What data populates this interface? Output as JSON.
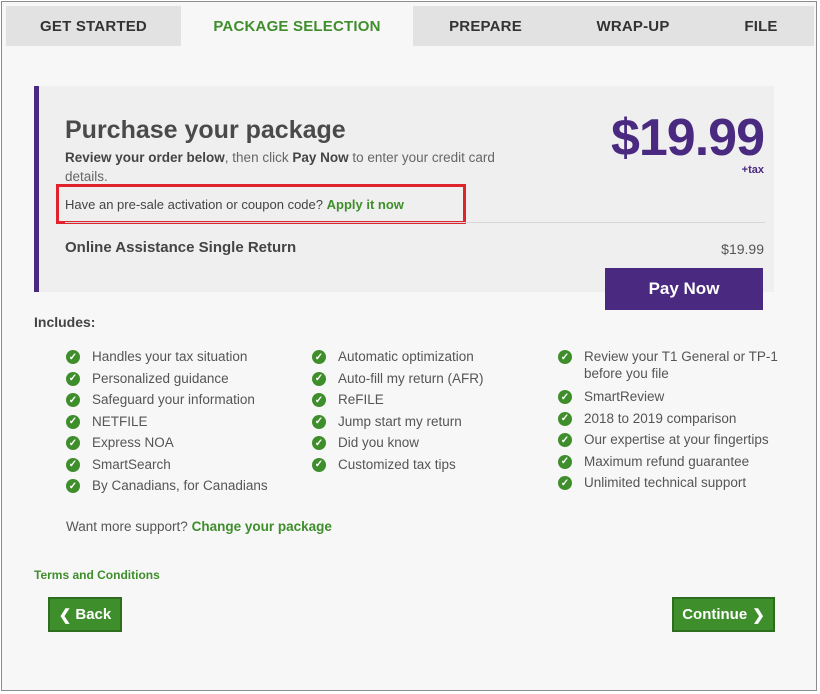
{
  "tabs": [
    {
      "label": "GET STARTED"
    },
    {
      "label": "PACKAGE SELECTION"
    },
    {
      "label": "PREPARE"
    },
    {
      "label": "WRAP-UP"
    },
    {
      "label": "FILE"
    }
  ],
  "purchase": {
    "title": "Purchase your package",
    "desc_pre": "Review your order below",
    "desc_mid": ", then click ",
    "desc_bold": "Pay Now",
    "desc_post": " to enter your credit card details.",
    "price": "$19.99",
    "tax_label": "+tax",
    "coupon_text": "Have an pre-sale activation or coupon code?",
    "coupon_link": "Apply it now",
    "line_item": "Online Assistance Single Return",
    "line_price": "$19.99",
    "pay_button": "Pay Now"
  },
  "includes": {
    "heading": "Includes:",
    "col1": [
      "Handles your tax situation",
      "Personalized guidance",
      "Safeguard your information",
      "NETFILE",
      "Express NOA",
      "SmartSearch",
      "By Canadians, for Canadians"
    ],
    "col2": [
      "Automatic optimization",
      "Auto-fill my return (AFR)",
      "ReFILE",
      "Jump start my return",
      "Did you know",
      "Customized tax tips"
    ],
    "col3": [
      "Review your T1 General or TP-1 before you file",
      "SmartReview",
      "2018 to 2019 comparison",
      "Our expertise at your fingertips",
      "Maximum refund guarantee",
      "Unlimited technical support"
    ]
  },
  "support": {
    "text": "Want more support?",
    "link": "Change your package"
  },
  "footer": {
    "terms": "Terms and Conditions",
    "back": "Back",
    "continue": "Continue"
  },
  "colors": {
    "purple": "#4a2a80",
    "green": "#3f8e2c",
    "highlight": "#e0242e"
  }
}
